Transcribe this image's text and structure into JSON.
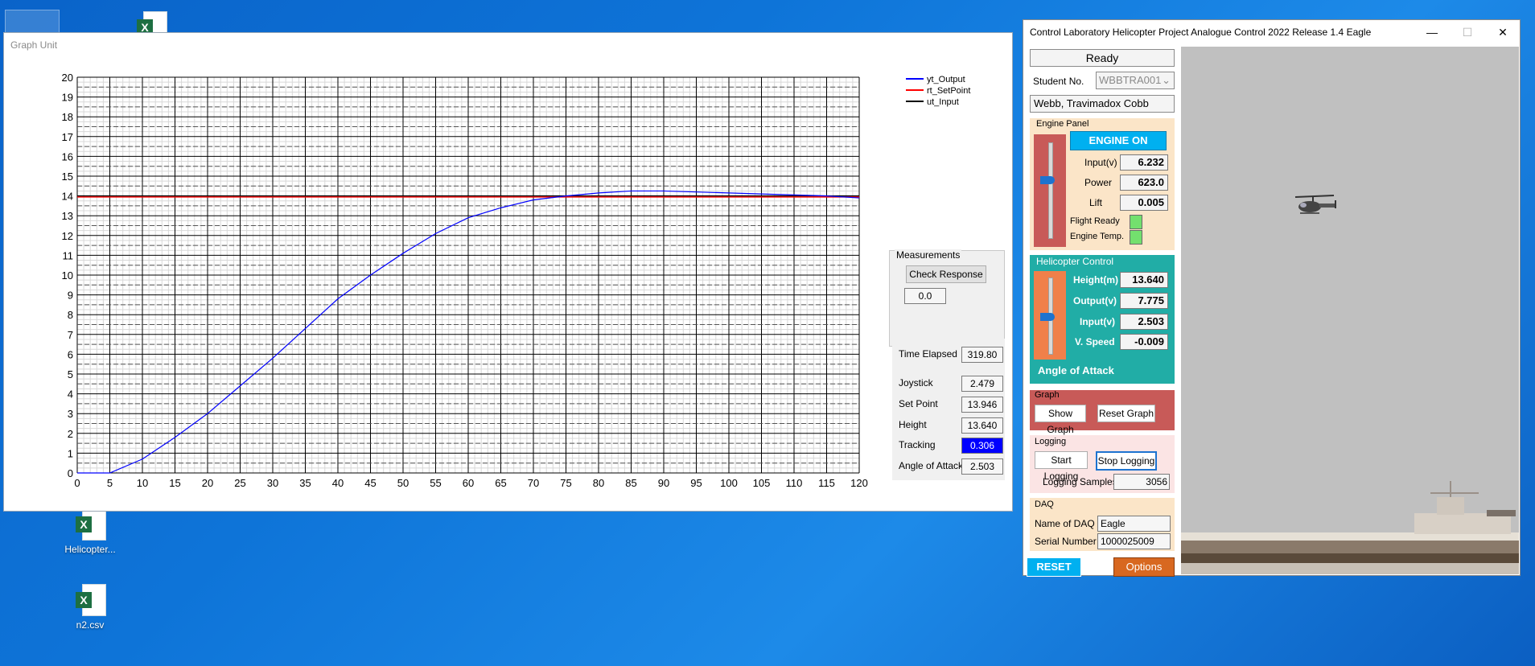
{
  "desktop": {
    "icons": [
      {
        "label": "Helicopter..."
      },
      {
        "label": "n2.csv"
      }
    ]
  },
  "graph_window": {
    "title": "Graph Unit",
    "measurements": {
      "title": "Measurements",
      "check_button": "Check Response",
      "value": "0.0"
    },
    "stats": {
      "time_elapsed_label": "Time Elapsed",
      "time_elapsed": "319.80",
      "joystick_label": "Joystick",
      "joystick": "2.479",
      "set_point_label": "Set Point",
      "set_point": "13.946",
      "height_label": "Height",
      "height": "13.640",
      "tracking_label": "Tracking",
      "tracking": "0.306",
      "angle_label": "Angle of Attack",
      "angle": "2.503"
    }
  },
  "chart_data": {
    "type": "line",
    "title": "",
    "xlabel": "",
    "ylabel": "",
    "xlim": [
      0,
      120
    ],
    "ylim": [
      0,
      20
    ],
    "x_ticks": [
      0,
      5,
      10,
      15,
      20,
      25,
      30,
      35,
      40,
      45,
      50,
      55,
      60,
      65,
      70,
      75,
      80,
      85,
      90,
      95,
      100,
      105,
      110,
      115,
      120
    ],
    "y_ticks": [
      0,
      1,
      2,
      3,
      4,
      5,
      6,
      7,
      8,
      9,
      10,
      11,
      12,
      13,
      14,
      15,
      16,
      17,
      18,
      19,
      20
    ],
    "grid": true,
    "legend_position": "top-right",
    "series": [
      {
        "name": "yt_Output",
        "color": "#0000ff",
        "x": [
          0,
          5,
          10,
          15,
          20,
          25,
          30,
          35,
          40,
          45,
          50,
          55,
          60,
          65,
          70,
          75,
          80,
          85,
          90,
          95,
          100,
          105,
          110,
          115,
          120
        ],
        "y": [
          0,
          0,
          0.7,
          1.8,
          3.0,
          4.4,
          5.8,
          7.3,
          8.8,
          10.0,
          11.1,
          12.1,
          12.9,
          13.4,
          13.8,
          14.0,
          14.15,
          14.25,
          14.25,
          14.2,
          14.15,
          14.1,
          14.05,
          14.0,
          13.9
        ]
      },
      {
        "name": "rt_SetPoint",
        "color": "#ff0000",
        "x": [
          0,
          120
        ],
        "y": [
          13.946,
          13.946
        ]
      },
      {
        "name": "ut_Input",
        "color": "#000000",
        "x": [
          0,
          120
        ],
        "y": [
          14.0,
          14.0
        ]
      }
    ]
  },
  "control_window": {
    "title": "Control Laboratory Helicopter Project Analogue Control 2022 Release 1.4 Eagle",
    "window_buttons": {
      "minimize": "—",
      "maximize": "☐",
      "close": "✕"
    },
    "status": "Ready",
    "student_no_label": "Student No.",
    "student_no": "WBBTRA001",
    "student_name": "Webb, Travimadox Cobb",
    "engine_panel": {
      "title": "Engine Panel",
      "engine_button": "ENGINE ON",
      "input_label": "Input(v)",
      "input": "6.232",
      "power_label": "Power",
      "power": "623.0",
      "lift_label": "Lift",
      "lift": "0.005",
      "flight_ready_label": "Flight Ready",
      "engine_temp_label": "Engine Temp."
    },
    "heli_control": {
      "title": "Helicopter Control",
      "height_label": "Height(m)",
      "height": "13.640",
      "output_label": "Output(v)",
      "output": "7.775",
      "input_label": "Input(v)",
      "input": "2.503",
      "vspeed_label": "V. Speed",
      "vspeed": "-0.009",
      "angle_label": "Angle of Attack"
    },
    "graph_panel": {
      "title": "Graph",
      "show": "Show Graph",
      "reset": "Reset Graph"
    },
    "logging_panel": {
      "title": "Logging",
      "start": "Start Logging",
      "stop": "Stop Logging",
      "samples_label": "Logging Samples",
      "samples": "3056"
    },
    "daq_panel": {
      "title": "DAQ",
      "name_label": "Name of DAQ",
      "name": "Eagle",
      "serial_label": "Serial Number",
      "serial": "1000025009"
    },
    "reset_button": "RESET",
    "options_button": "Options",
    "colors": {
      "engine_bg": "#fbe5c8",
      "heli_bg": "#21ada6",
      "graph_bg": "#c85a58",
      "log_bg": "#fbe4e4",
      "daq_bg": "#fbe5c8",
      "accent_blue": "#00b0f0",
      "options_orange": "#d86820"
    }
  }
}
